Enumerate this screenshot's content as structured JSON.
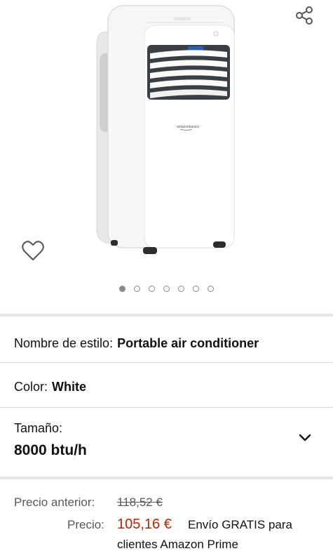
{
  "product": {
    "image_alt": "Portable air conditioner",
    "brand_mark": "amazonbasics",
    "gallery_count": 7,
    "gallery_active_index": 0
  },
  "options": {
    "style": {
      "label": "Nombre de estilo:",
      "value": "Portable air conditioner"
    },
    "color": {
      "label": "Color:",
      "value": "White"
    },
    "size": {
      "label": "Tamaño:",
      "value": "8000 btu/h"
    }
  },
  "pricing": {
    "previous_label": "Precio anterior:",
    "previous_value": "118,52 €",
    "current_label": "Precio:",
    "current_value": "105,16 €",
    "shipping_line1": "Envío GRATIS para",
    "shipping_line2": "clientes Amazon Prime"
  },
  "colors": {
    "price": "#b12704",
    "muted_text": "#565959",
    "icon": "#555555"
  }
}
